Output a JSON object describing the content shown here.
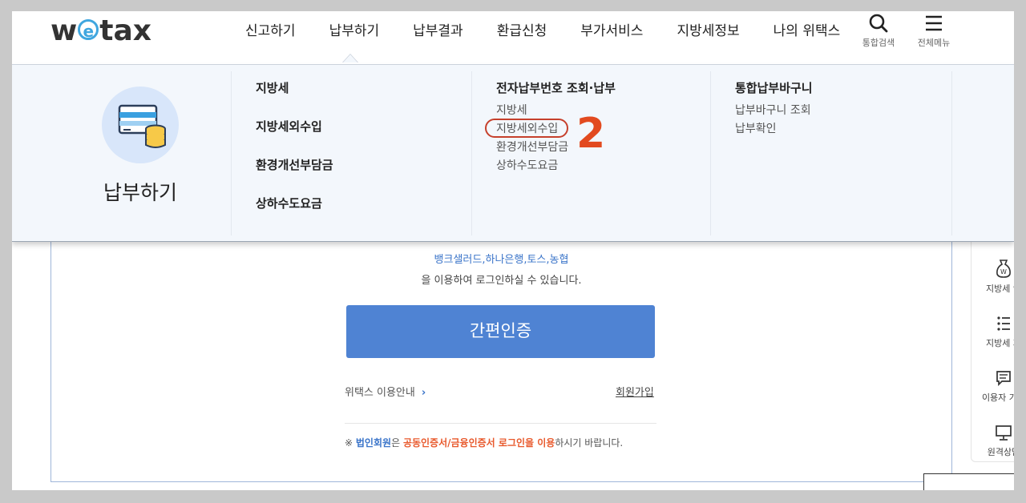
{
  "header": {
    "logo": {
      "prefix": "w",
      "e": "e",
      "suffix": "tax"
    },
    "gnb": [
      "신고하기",
      "납부하기",
      "납부결과",
      "환급신청",
      "부가서비스",
      "지방세정보",
      "나의 위택스"
    ],
    "search_label": "통합검색",
    "menu_label": "전체메뉴"
  },
  "mega_menu": {
    "title": "납부하기",
    "icon": "card-coins-icon",
    "col1": [
      "지방세",
      "지방세외수입",
      "환경개선부담금",
      "상하수도요금"
    ],
    "col2": {
      "title": "전자납부번호 조회·납부",
      "items": [
        "지방세",
        "지방세외수입",
        "환경개선부담금",
        "상하수도요금"
      ]
    },
    "col3": {
      "title": "통합납부바구니",
      "items": [
        "납부바구니 조회",
        "납부확인"
      ]
    },
    "step_number": "2",
    "highlight_color": "#e24a1f"
  },
  "login": {
    "banks": "뱅크샐러드,하나은행,토스,농협",
    "can_login": "을 이용하여 로그인하실 수 있습니다.",
    "easy_auth_button": "간편인증",
    "guide_link": "위택스 이용안내",
    "guide_arrow": "›",
    "join_link": "회원가입",
    "notice": {
      "mark": "※",
      "corp": "법인회원",
      "is": "은",
      "cert": "공동인증서/금융인증서 로그인을 이용",
      "rest": "하시기 바랍니다."
    }
  },
  "quick_menu": [
    {
      "label": "지방세 인",
      "icon": "money-bag-icon"
    },
    {
      "label": "지방세 자",
      "icon": "list-icon"
    },
    {
      "label": "이용자 가이",
      "icon": "chat-icon"
    },
    {
      "label": "원격상담",
      "icon": "monitor-icon"
    }
  ]
}
